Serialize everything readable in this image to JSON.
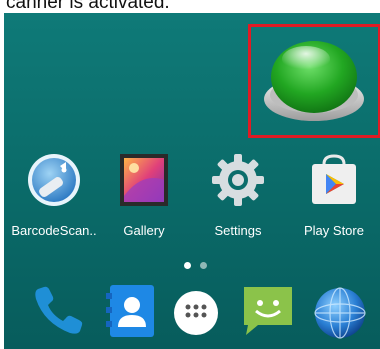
{
  "caption": "canner is activated.",
  "apps": [
    {
      "label": "BarcodeScan..",
      "icon": "barcode-scanner-icon"
    },
    {
      "label": "Gallery",
      "icon": "gallery-icon"
    },
    {
      "label": "Settings",
      "icon": "settings-icon"
    },
    {
      "label": "Play Store",
      "icon": "play-store-icon"
    }
  ],
  "page_indicator": {
    "pages": 2,
    "current": 1
  },
  "dock": [
    "phone-icon",
    "contacts-icon",
    "app-drawer-icon",
    "messaging-icon",
    "browser-icon"
  ],
  "colors": {
    "highlight": "#e01b24",
    "wallpaper": "#0b6d6b",
    "button_green": "#2fb52f"
  }
}
